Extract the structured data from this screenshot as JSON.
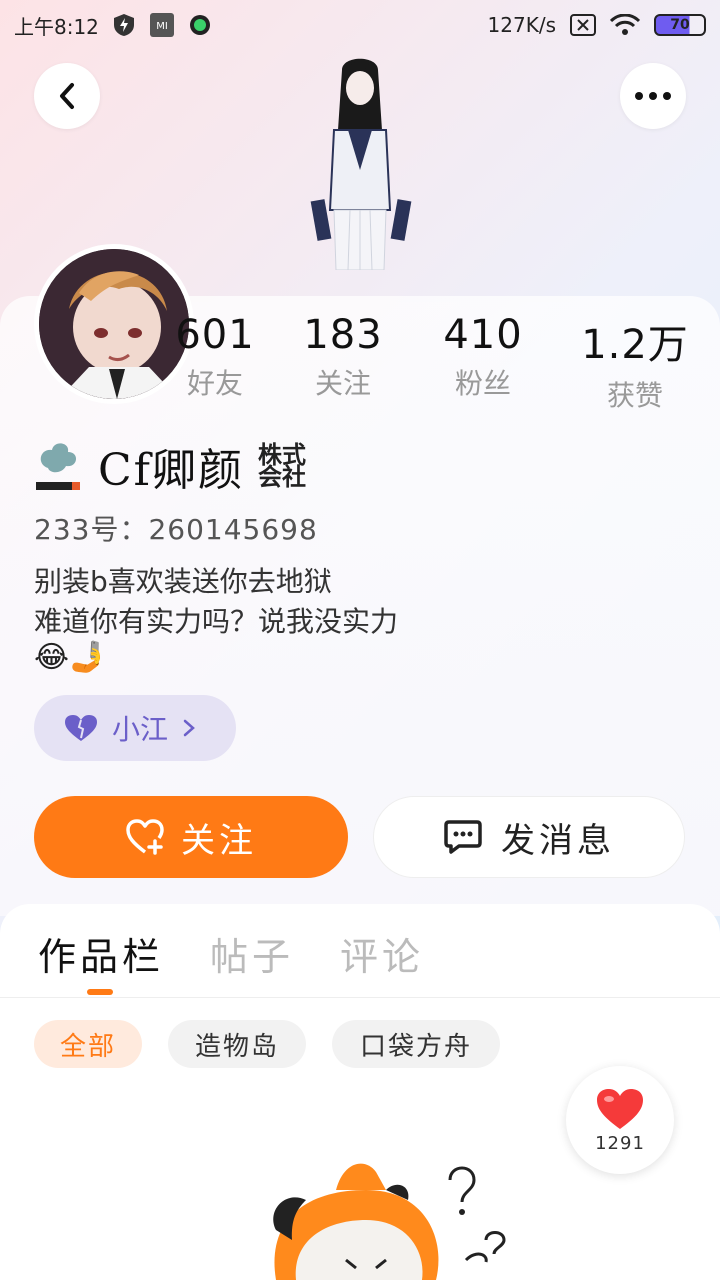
{
  "status_bar": {
    "time": "上午8:12",
    "net_speed": "127K/s",
    "battery": "70",
    "icons": [
      "shield-icon",
      "mi-icon",
      "spotify-icon",
      "no-sim-icon",
      "wifi-icon",
      "battery-icon"
    ]
  },
  "header": {
    "back_icon": "chevron-left-icon",
    "more_icon": "more-dots-icon"
  },
  "profile": {
    "stats": [
      {
        "value": "601",
        "label": "好友"
      },
      {
        "value": "183",
        "label": "关注"
      },
      {
        "value": "410",
        "label": "粉丝"
      },
      {
        "value": "1.2万",
        "label": "获赞"
      }
    ],
    "username": "Cf卿颜",
    "badge": "株式会社",
    "uid": "233号：260145698",
    "bio_line1": "别装b喜欢装送你去地狱",
    "bio_line2": "难道你有实力吗？说我没实力",
    "bio_emojis": "😂🤳",
    "tag": "小江"
  },
  "actions": {
    "follow": "关注",
    "message": "发消息"
  },
  "tabs": [
    {
      "label": "作品栏",
      "active": true
    },
    {
      "label": "帖子",
      "active": false
    },
    {
      "label": "评论",
      "active": false
    }
  ],
  "filters": [
    {
      "label": "全部",
      "active": true
    },
    {
      "label": "造物岛",
      "active": false
    },
    {
      "label": "口袋方舟",
      "active": false
    }
  ],
  "like": {
    "count": "1291"
  },
  "colors": {
    "accent": "#ff7a15",
    "tag_purple": "#6b5fc9",
    "heart_red": "#f53a3a"
  }
}
